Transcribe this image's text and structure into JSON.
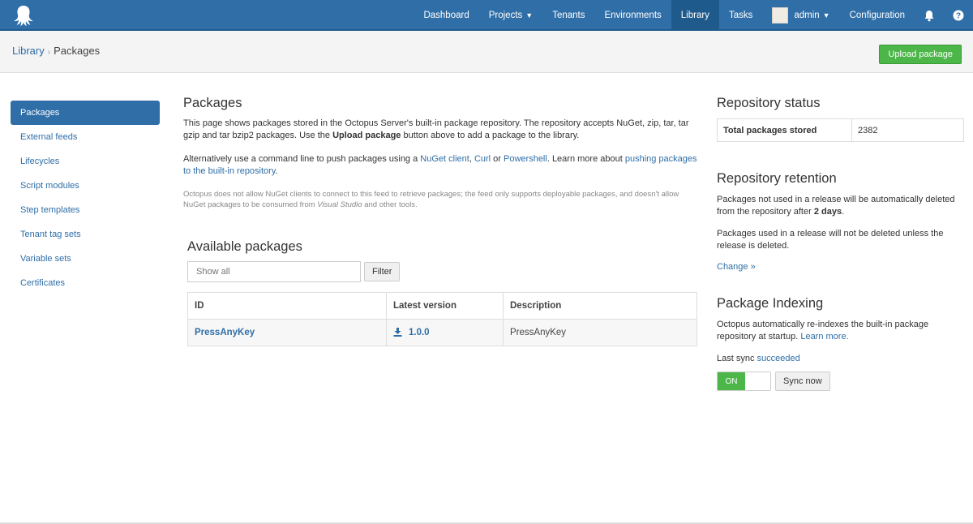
{
  "nav": {
    "items": [
      {
        "label": "Dashboard"
      },
      {
        "label": "Projects"
      },
      {
        "label": "Tenants"
      },
      {
        "label": "Environments"
      },
      {
        "label": "Library"
      },
      {
        "label": "Tasks"
      }
    ],
    "user": "admin",
    "configuration": "Configuration",
    "icons": [
      "octopus-logo-icon",
      "bell-icon",
      "help-icon"
    ],
    "active_item": "Library"
  },
  "breadcrumb": {
    "parent": "Library",
    "current": "Packages"
  },
  "upload_button": "Upload package",
  "sidebar": {
    "items": [
      {
        "label": "Packages"
      },
      {
        "label": "External feeds"
      },
      {
        "label": "Lifecycles"
      },
      {
        "label": "Script modules"
      },
      {
        "label": "Step templates"
      },
      {
        "label": "Tenant tag sets"
      },
      {
        "label": "Variable sets"
      },
      {
        "label": "Certificates"
      }
    ]
  },
  "main": {
    "title": "Packages",
    "intro_1a": "This page shows packages stored in the Octopus Server's built-in package repository. The repository accepts NuGet, zip, tar, tar gzip and tar bzip2 packages. Use the ",
    "intro_1b": "Upload package",
    "intro_1c": " button above to add a package to the library.",
    "intro_2a": "Alternatively use a command line to push packages using a ",
    "link_nuget": "NuGet client",
    "comma": ", ",
    "link_curl": "Curl",
    "or": " or ",
    "link_powershell": "Powershell",
    "intro_2b": ". Learn more about ",
    "link_pushing": "pushing packages to the built-in repository",
    "period": ".",
    "note_a": "Octopus does not allow NuGet clients to connect to this feed to retrieve packages; the feed only supports deployable packages, and doesn't allow NuGet packages to be consumed from ",
    "note_em": "Visual Studio",
    "note_b": " and other tools.",
    "available_title": "Available packages",
    "filter_placeholder": "Show all",
    "filter_button": "Filter",
    "table": {
      "columns": [
        "ID",
        "Latest version",
        "Description"
      ],
      "rows": [
        {
          "id": "PressAnyKey",
          "version": "1.0.0",
          "description": "PressAnyKey"
        }
      ]
    }
  },
  "right": {
    "status_title": "Repository status",
    "status_label": "Total packages stored",
    "status_value": "2382",
    "retention_title": "Repository retention",
    "retention_p1a": "Packages not used in a release will be automatically deleted from the repository after ",
    "retention_p1b": "2 days",
    "retention_p1c": ".",
    "retention_p2": "Packages used in a release will not be deleted unless the release is deleted.",
    "change_link": "Change »",
    "indexing_title": "Package Indexing",
    "indexing_p1": "Octopus automatically re-indexes the built-in package repository at startup. ",
    "learn_more": "Learn more.",
    "last_sync_label": "Last sync ",
    "last_sync_status": "succeeded",
    "toggle_label": "ON",
    "sync_button": "Sync now"
  },
  "colors": {
    "brand_blue": "#2f6ea7",
    "nav_active": "#1f5a8d",
    "success_green": "#4cb648"
  }
}
